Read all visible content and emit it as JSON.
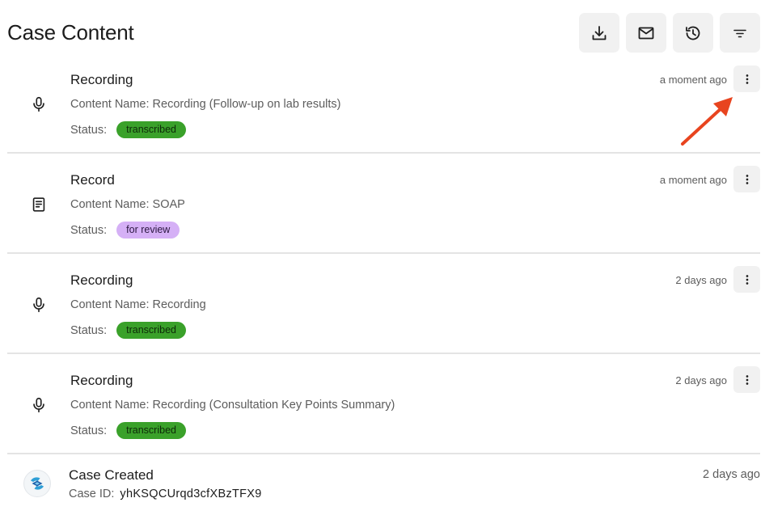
{
  "header": {
    "title": "Case Content"
  },
  "toolbar": [
    {
      "icon": "download-icon"
    },
    {
      "icon": "mail-icon"
    },
    {
      "icon": "history-icon"
    },
    {
      "icon": "filter-icon"
    }
  ],
  "items": [
    {
      "icon": "microphone-icon",
      "title": "Recording",
      "content_name": "Content Name: Recording (Follow-up on lab results)",
      "status_label": "Status:",
      "status": "transcribed",
      "status_color": "#3aa12a",
      "time": "a moment ago"
    },
    {
      "icon": "document-icon",
      "title": "Record",
      "content_name": "Content Name: SOAP",
      "status_label": "Status:",
      "status": "for review",
      "status_color": "#d5b0f6",
      "time": "a moment ago"
    },
    {
      "icon": "microphone-icon",
      "title": "Recording",
      "content_name": "Content Name: Recording",
      "status_label": "Status:",
      "status": "transcribed",
      "status_color": "#3aa12a",
      "time": "2 days ago"
    },
    {
      "icon": "microphone-icon",
      "title": "Recording",
      "content_name": "Content Name: Recording (Consultation Key Points Summary)",
      "status_label": "Status:",
      "status": "transcribed",
      "status_color": "#3aa12a",
      "time": "2 days ago"
    }
  ],
  "case_created": {
    "title": "Case Created",
    "id_label": "Case ID:",
    "id_value": "yhKSQCUrqd3cfXBzTFX9",
    "time": "2 days ago",
    "logo": "app-logo"
  },
  "annotation": {
    "arrow_color": "#e8441f"
  }
}
